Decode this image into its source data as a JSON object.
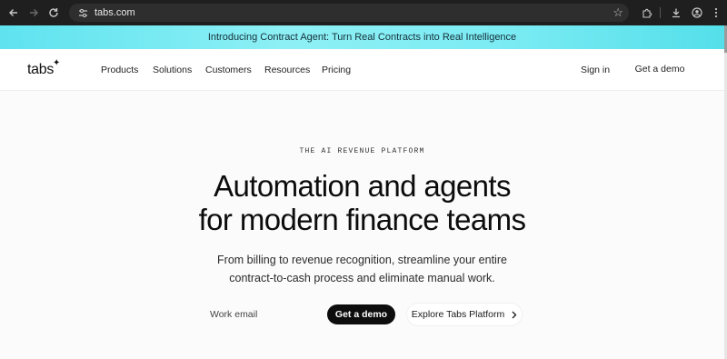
{
  "browser": {
    "url": "tabs.com",
    "icons": [
      "back-icon",
      "forward-icon",
      "reload-icon",
      "site-settings-icon",
      "bookmark-star-icon",
      "extensions-icon",
      "downloads-icon",
      "profile-icon",
      "menu-icon"
    ]
  },
  "banner": {
    "text": "Introducing Contract Agent: Turn Real Contracts into Real Intelligence",
    "colors": [
      "#5fe3ef",
      "#8ef0f5"
    ]
  },
  "header": {
    "logo": "tabs",
    "nav": [
      "Products",
      "Solutions",
      "Customers",
      "Resources",
      "Pricing"
    ],
    "sign_in": "Sign in",
    "get_demo": "Get a demo"
  },
  "hero": {
    "eyebrow": "THE AI REVENUE PLATFORM",
    "headline_line1": "Automation and agents",
    "headline_line2": "for modern finance teams",
    "sub_line1": "From billing to revenue recognition, streamline your entire",
    "sub_line2": "contract-to-cash process and eliminate manual work.",
    "email_placeholder": "Work email",
    "cta_primary": "Get a demo",
    "cta_secondary": "Explore Tabs Platform"
  }
}
